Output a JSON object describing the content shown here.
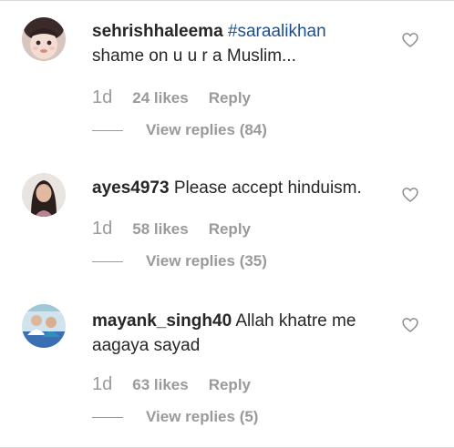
{
  "comments": [
    {
      "username": "sehrishhaleema",
      "hashtag": "#saraalikhan",
      "text": "shame on u u r a Muslim...",
      "time": "1d",
      "likes": "24 likes",
      "reply_label": "Reply",
      "view_replies": "View replies (84)",
      "avatar_icon": "avatar-child-photo"
    },
    {
      "username": "ayes4973",
      "text": "Please accept hinduism.",
      "time": "1d",
      "likes": "58 likes",
      "reply_label": "Reply",
      "view_replies": "View replies (35)",
      "avatar_icon": "avatar-woman-photo"
    },
    {
      "username": "mayank_singh40",
      "text": "Allah khatre me aagaya sayad",
      "time": "1d",
      "likes": "63 likes",
      "reply_label": "Reply",
      "view_replies": "View replies (5)",
      "avatar_icon": "avatar-group-photo"
    }
  ],
  "icons": {
    "like": "heart-outline-icon"
  },
  "colors": {
    "text": "#262626",
    "muted": "#9a9a9a",
    "hashtag": "#1f4e8c"
  }
}
